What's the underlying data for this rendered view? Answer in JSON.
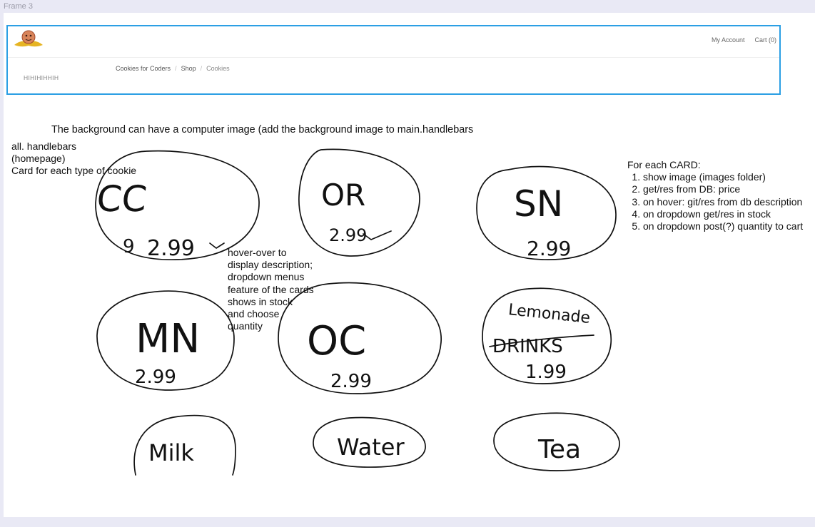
{
  "frame": {
    "label": "Frame 3"
  },
  "header": {
    "nav": {
      "account": "My Account",
      "cart": "Cart (0)"
    },
    "breadcrumb": {
      "home": "Cookies for Coders",
      "sep": "/",
      "shop": "Shop",
      "current": "Cookies"
    },
    "placeholder_text": "HIHIHIHHIH"
  },
  "notes": {
    "background": "The background can have a computer image (add the background image to main.handlebars",
    "left": [
      "all. handlebars",
      "(homepage)",
      "Card for each type of cookie"
    ],
    "hover": [
      "hover-over to",
      "display description;",
      "dropdown menus",
      "feature of the cards",
      "shows in stock",
      "and choose",
      "quantity"
    ],
    "card_title": "For each CARD:",
    "card_items": [
      "show image (images folder)",
      "get/res from DB: price",
      "on hover: git/res from db description",
      "on dropdown get/res in stock",
      "on dropdown post(?) quantity to cart"
    ]
  },
  "cards": [
    {
      "label": "CC",
      "price": "2.99",
      "extra": "9"
    },
    {
      "label": "OR",
      "price": "2.99"
    },
    {
      "label": "SN",
      "price": "2.99"
    },
    {
      "label": "MN",
      "price": "2.99"
    },
    {
      "label": "OC",
      "price": "2.99"
    },
    {
      "label": "Lemonade",
      "struck": "DRINKS",
      "price": "1.99"
    },
    {
      "label": "Milk"
    },
    {
      "label": "Water"
    },
    {
      "label": "Tea"
    }
  ]
}
